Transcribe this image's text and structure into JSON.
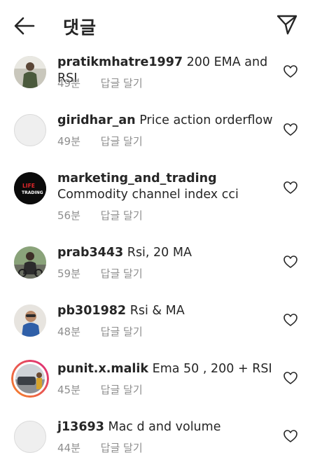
{
  "header": {
    "title": "댓글"
  },
  "comments": [
    {
      "username": "pratikmhatre1997",
      "text": "200 EMA and RSI",
      "time": "49분",
      "reply_label": "답글 달기"
    },
    {
      "username": "giridhar_an",
      "text": "Price action orderflow",
      "time": "49분",
      "reply_label": "답글 달기"
    },
    {
      "username": "marketing_and_trading",
      "text": "Commodity channel index cci",
      "time": "56분",
      "reply_label": "답글 달기",
      "avatar_logo_text": "LIFE TRADING"
    },
    {
      "username": "prab3443",
      "text": "Rsi, 20 MA",
      "time": "59분",
      "reply_label": "답글 달기"
    },
    {
      "username": "pb301982",
      "text": "Rsi & MA",
      "time": "48분",
      "reply_label": "답글 달기"
    },
    {
      "username": "punit.x.malik",
      "text": "Ema 50 , 200 + RSI",
      "time": "45분",
      "reply_label": "답글 달기"
    },
    {
      "username": "j13693",
      "text": "Mac d and volume",
      "time": "44분",
      "reply_label": "답글 달기"
    }
  ],
  "colors": {
    "text": "#262626",
    "meta": "#8e8e8e",
    "story_ring_start": "#f58529",
    "story_ring_end": "#dd2a7b"
  }
}
